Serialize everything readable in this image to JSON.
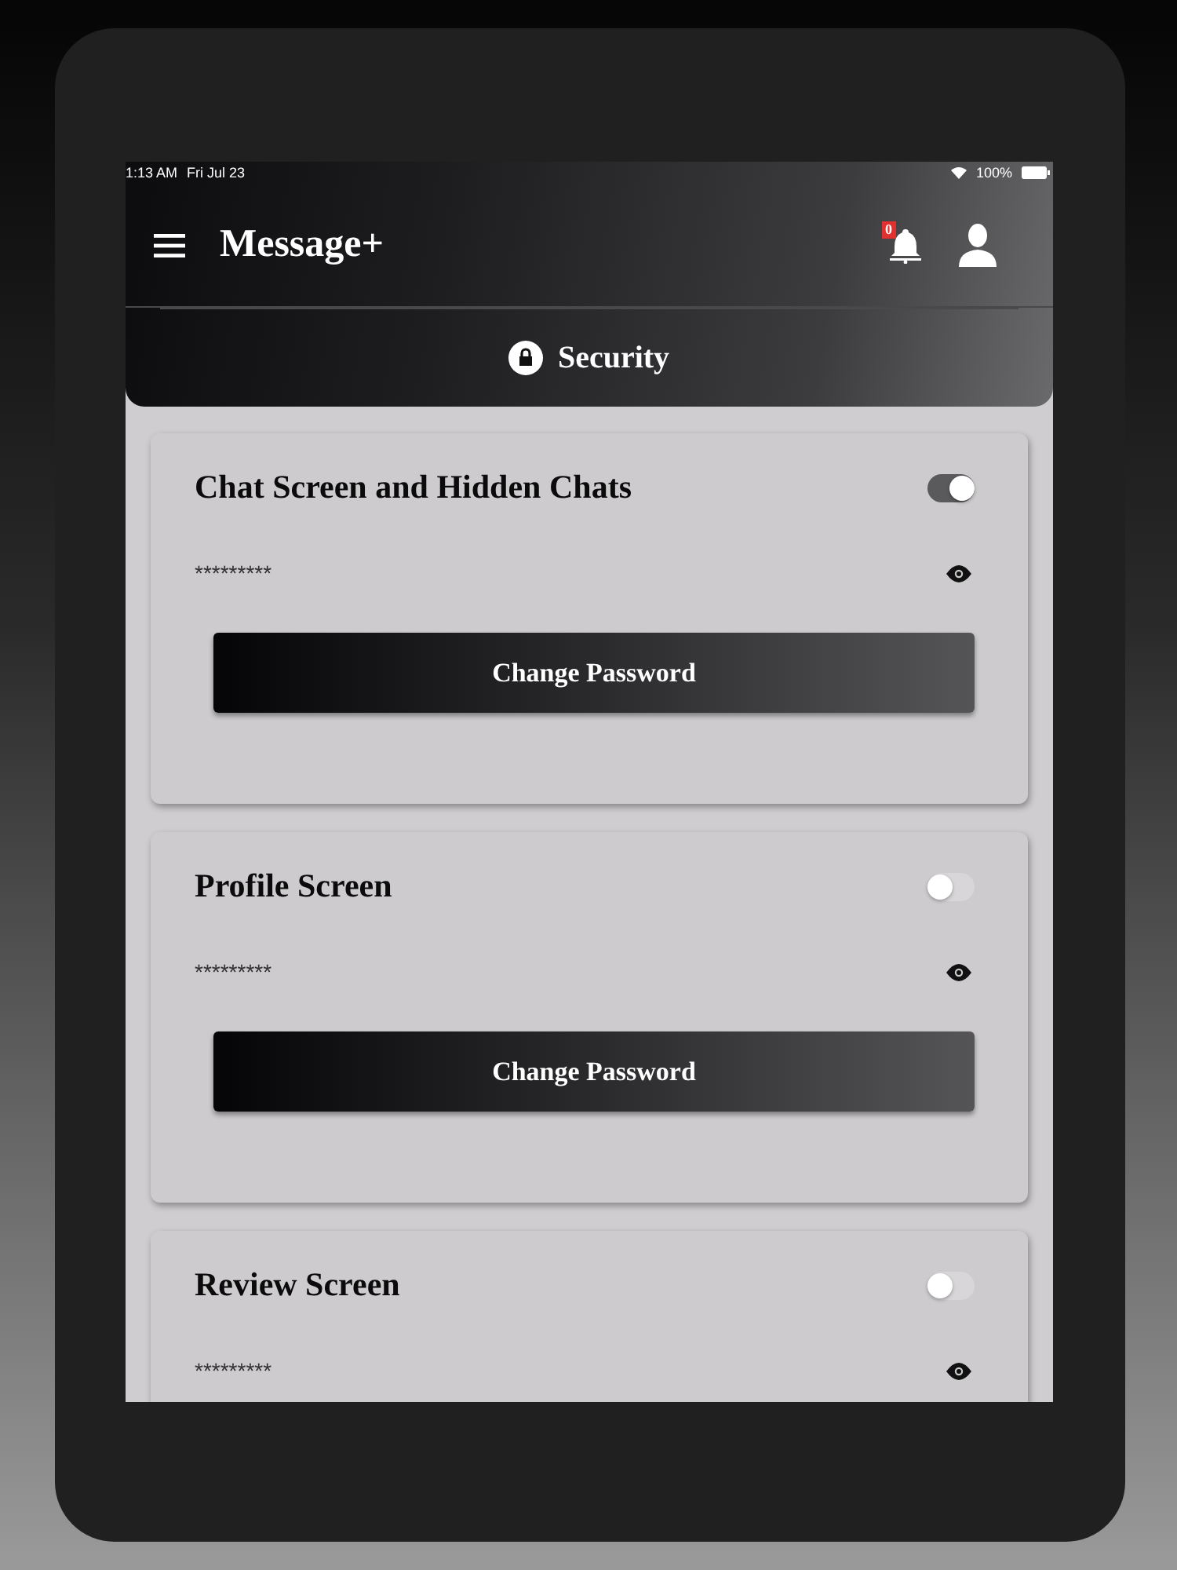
{
  "status_bar": {
    "time": "1:13 AM",
    "date": "Fri Jul 23",
    "battery": "100%"
  },
  "app_bar": {
    "title": "Message+",
    "notification_count": "0"
  },
  "section": {
    "title": "Security"
  },
  "cards": [
    {
      "title": "Chat Screen and Hidden Chats",
      "on": true,
      "password": "*********",
      "button": "Change Password"
    },
    {
      "title": "Profile Screen",
      "on": false,
      "password": "*********",
      "button": "Change Password"
    },
    {
      "title": "Review Screen",
      "on": false,
      "password": "*********"
    }
  ]
}
